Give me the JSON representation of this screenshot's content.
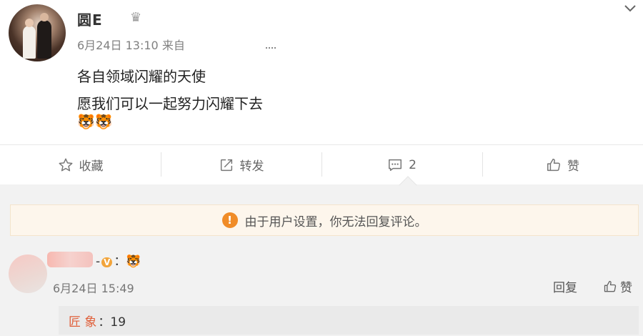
{
  "post": {
    "username": "圆E",
    "crown_icon": "crown-icon",
    "timestamp": "6月24日 13:10",
    "source_prefix": "来自",
    "lines": [
      "各自领域闪耀的天使",
      "愿我们可以一起努力闪耀下去"
    ],
    "emojis": "🐯🐯"
  },
  "actions": {
    "favorite": {
      "label": "收藏",
      "icon": "star-outline-icon"
    },
    "repost": {
      "label": "转发",
      "icon": "share-icon"
    },
    "comment": {
      "label": "2",
      "icon": "comment-icon"
    },
    "like": {
      "label": "赞",
      "icon": "thumbs-up-icon"
    }
  },
  "notice": {
    "icon": "warning-icon",
    "text": "由于用户设置，你无法回复评论。"
  },
  "comment": {
    "badge_text": "V",
    "tail_text": "：🐯",
    "timestamp": "6月24日 15:49",
    "reply_label": "回复",
    "like_label": "赞",
    "sub_reply": {
      "user": "匠    象",
      "text": "：19"
    }
  },
  "colors": {
    "accent_orange": "#f08c28",
    "notice_bg": "#fdf6ec",
    "sub_user": "#e0603b"
  }
}
